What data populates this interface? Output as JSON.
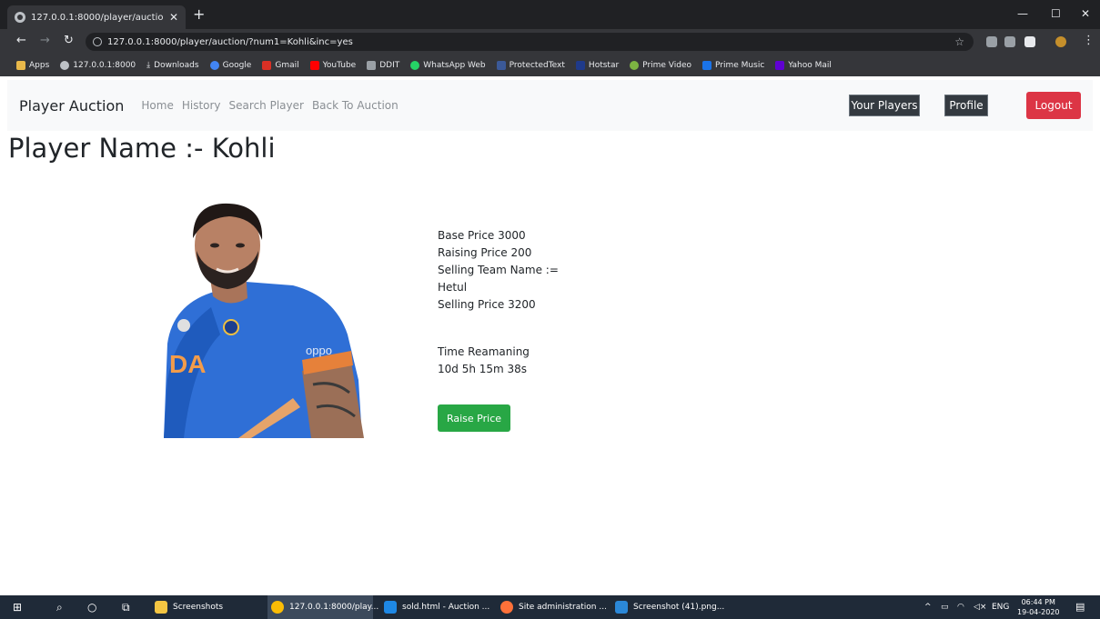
{
  "browser": {
    "tab_title": "127.0.0.1:8000/player/auction/?n",
    "url": "127.0.0.1:8000/player/auction/?num1=Kohli&inc=yes",
    "bookmarks": [
      {
        "label": "Apps",
        "icon": "apps-grid-icon",
        "color": "#e8b84a"
      },
      {
        "label": "127.0.0.1:8000",
        "icon": "globe-icon",
        "color": "#bdc1c6"
      },
      {
        "label": "Downloads",
        "icon": "download-icon",
        "color": "#e8eaed"
      },
      {
        "label": "Google",
        "icon": "google-icon",
        "color": "#4285f4"
      },
      {
        "label": "Gmail",
        "icon": "gmail-icon",
        "color": "#d93025"
      },
      {
        "label": "YouTube",
        "icon": "youtube-icon",
        "color": "#ff0000"
      },
      {
        "label": "DDIT",
        "icon": "ddit-icon",
        "color": "#9aa0a6"
      },
      {
        "label": "WhatsApp Web",
        "icon": "whatsapp-icon",
        "color": "#25d366"
      },
      {
        "label": "ProtectedText",
        "icon": "protectedtext-icon",
        "color": "#3b5998"
      },
      {
        "label": "Hotstar",
        "icon": "hotstar-icon",
        "color": "#1f3a8a"
      },
      {
        "label": "Prime Video",
        "icon": "prime-video-icon",
        "color": "#7cb342"
      },
      {
        "label": "Prime Music",
        "icon": "prime-music-icon",
        "color": "#1a73e8"
      },
      {
        "label": "Yahoo Mail",
        "icon": "yahoo-mail-icon",
        "color": "#6001d2"
      }
    ]
  },
  "navbar": {
    "brand": "Player Auction",
    "links": [
      "Home",
      "History",
      "Search Player",
      "Back To Auction"
    ],
    "your_players": "Your Players",
    "profile": "Profile",
    "logout": "Logout",
    "logout_color": "#dc3545"
  },
  "player": {
    "heading": "Player Name :- Kohli",
    "details": [
      "Base Price 3000",
      "Raising Price 200",
      "Selling Team Name :=",
      "Hetul",
      "Selling Price 3200"
    ],
    "time_label": "Time Reamaning",
    "time_value": "10d 5h 15m 38s",
    "raise_button": "Raise Price",
    "raise_color": "#28a745"
  },
  "taskbar": {
    "items": [
      {
        "label": "Screenshots",
        "icon": "folder-icon",
        "color": "#f4c542"
      },
      {
        "label": "127.0.0.1:8000/play...",
        "icon": "chrome-icon",
        "color": "#fbbc05"
      },
      {
        "label": "sold.html - Auction ...",
        "icon": "vscode-icon",
        "color": "#1e88e5"
      },
      {
        "label": "Site administration ...",
        "icon": "firefox-icon",
        "color": "#ff7139"
      },
      {
        "label": "Screenshot (41).png...",
        "icon": "photos-icon",
        "color": "#2b88d8"
      }
    ],
    "language": "ENG",
    "time": "06:44 PM",
    "date": "19-04-2020"
  }
}
